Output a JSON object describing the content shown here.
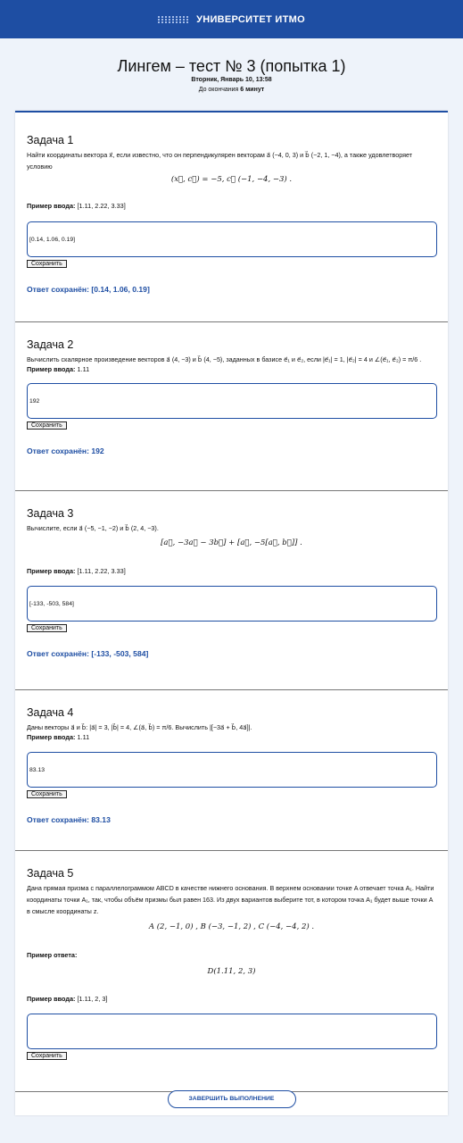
{
  "header": {
    "logo_text": "УНИВЕРСИТЕТ ИТМО"
  },
  "page": {
    "title": "Лингем – тест № 3 (попытка 1)",
    "date": "Вторник, Январь 10, 13:58",
    "remain_prefix": "До окончания",
    "remain_value": "6 минут"
  },
  "tasks": [
    {
      "title": "Задача 1",
      "text": "Найти координаты вектора x⃗, если известно, что он перпендикулярен векторам a⃗ (−4, 0, 3) и b⃗ (−2, 1, −4), а также удовлетворяет условию",
      "formula": "(x⃗, c⃗) = −5,  c⃗ (−1, −4, −3) .",
      "example_label": "Пример ввода:",
      "example_value": "[1.11, 2.22, 3.33]",
      "input_value": "[0.14, 1.06, 0.19]",
      "save_label": "Сохранить",
      "saved_text": "Ответ сохранён: [0.14, 1.06, 0.19]"
    },
    {
      "title": "Задача 2",
      "text": "Вычислить скалярное произведение векторов a⃗ (4, −3) и b⃗ (4, −5), заданных в базисе e⃗₁ и e⃗₂, если |e⃗₁| = 1, |e⃗₂| = 4 и ∠(e⃗₁, e⃗₂) = π/6 .",
      "example_label": "Пример ввода:",
      "example_value": "1.11",
      "input_value": "192",
      "save_label": "Сохранить",
      "saved_text": "Ответ сохранён: 192"
    },
    {
      "title": "Задача 3",
      "text": "Вычислите, если a⃗ (−5, −1, −2) и b⃗ (2, 4, −3).",
      "formula": "[a⃗, −3a⃗ − 3b⃗] + [a⃗, −5[a⃗, b⃗]] .",
      "example_label": "Пример ввода:",
      "example_value": "[1.11, 2.22, 3.33]",
      "input_value": "[-133, -503, 584]",
      "save_label": "Сохранить",
      "saved_text": "Ответ сохранён: [-133, -503, 584]"
    },
    {
      "title": "Задача 4",
      "text": "Даны векторы a⃗ и b⃗: |a⃗| = 3, |b⃗| = 4, ∠(a⃗, b⃗) = π/6. Вычислить |[−3a⃗ + b⃗, 4a⃗]|.",
      "example_label": "Пример ввода:",
      "example_value": "1.11",
      "input_value": "83.13",
      "save_label": "Сохранить",
      "saved_text": "Ответ сохранён: 83.13"
    },
    {
      "title": "Задача 5",
      "text": "Дана прямая призма с параллелограммом ABCD в качестве нижнего основания. В верхнем основании точке A отвечает точка A₁. Найти координаты точки A₁, так, чтобы объём призмы был равен 163. Из двух вариантов выберите тот, в котором точка A₁ будет выше точки A в смысле координаты z.",
      "formula": "A (2, −1, 0) ,  B (−3, −1, 2) ,  C (−4, −4, 2) .",
      "answer_example_label": "Пример ответа:",
      "answer_example_formula": "D(1.11, 2, 3)",
      "example_label": "Пример ввода:",
      "example_value": "[1.11, 2, 3]",
      "input_value": "",
      "save_label": "Сохранить"
    }
  ],
  "finish_label": "ЗАВЕРШИТЬ ВЫПОЛНЕНИЕ"
}
